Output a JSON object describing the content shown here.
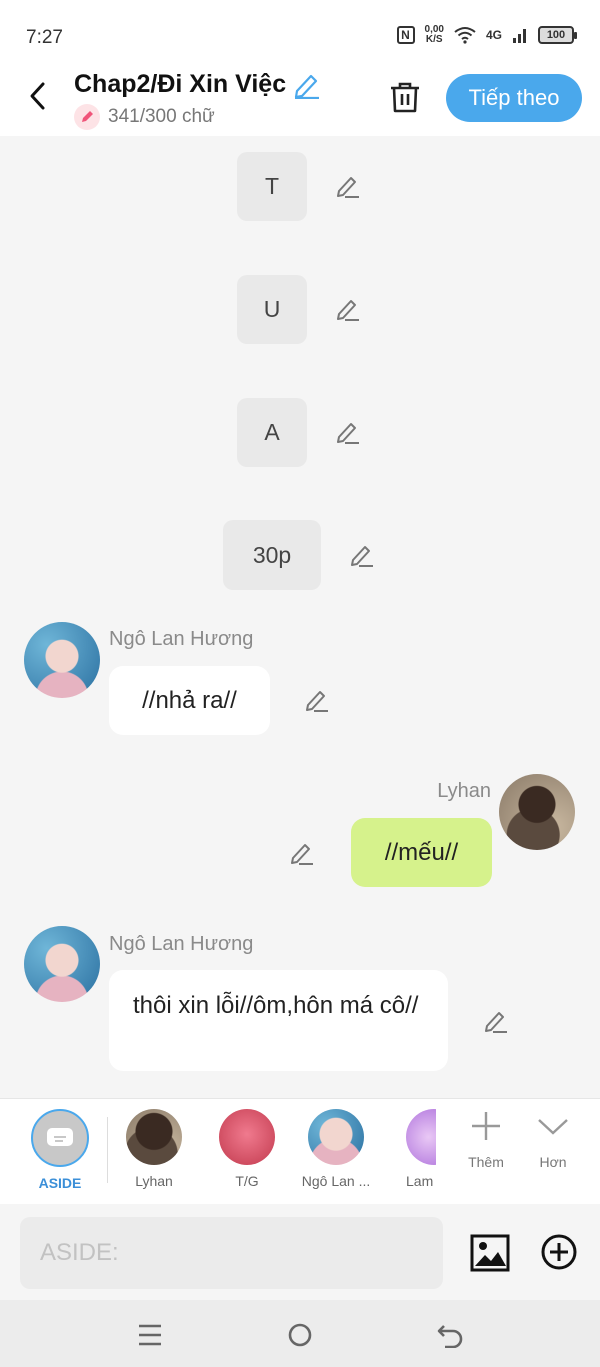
{
  "status_bar": {
    "time": "7:27",
    "speed_top": "0,00",
    "speed_unit": "K/S",
    "network": "4G",
    "battery": "100"
  },
  "header": {
    "title": "Chap2/Đi Xin Việc",
    "word_count": "341/300 chữ",
    "next_label": "Tiếp theo"
  },
  "narrations": [
    "T",
    "U",
    "A",
    "30p"
  ],
  "messages": [
    {
      "sender": "Ngô Lan Hương",
      "text": "//nhả ra//"
    },
    {
      "sender": "Lyhan",
      "text": "//mếu//"
    },
    {
      "sender": "Ngô Lan Hương",
      "text": "thôi xin lỗi//ôm,hôn má cô//"
    }
  ],
  "characters": [
    {
      "label": "ASIDE"
    },
    {
      "label": "Lyhan"
    },
    {
      "label": "T/G"
    },
    {
      "label": "Ngô Lan ..."
    },
    {
      "label": "Lam"
    }
  ],
  "actions": {
    "more_label": "Thêm",
    "collapse_label": "Hơn"
  },
  "input": {
    "placeholder": "ASIDE:"
  },
  "colors": {
    "accent": "#4aa8ec",
    "green_bubble": "#d6f28c",
    "aside_label": "#3b8fd8"
  }
}
